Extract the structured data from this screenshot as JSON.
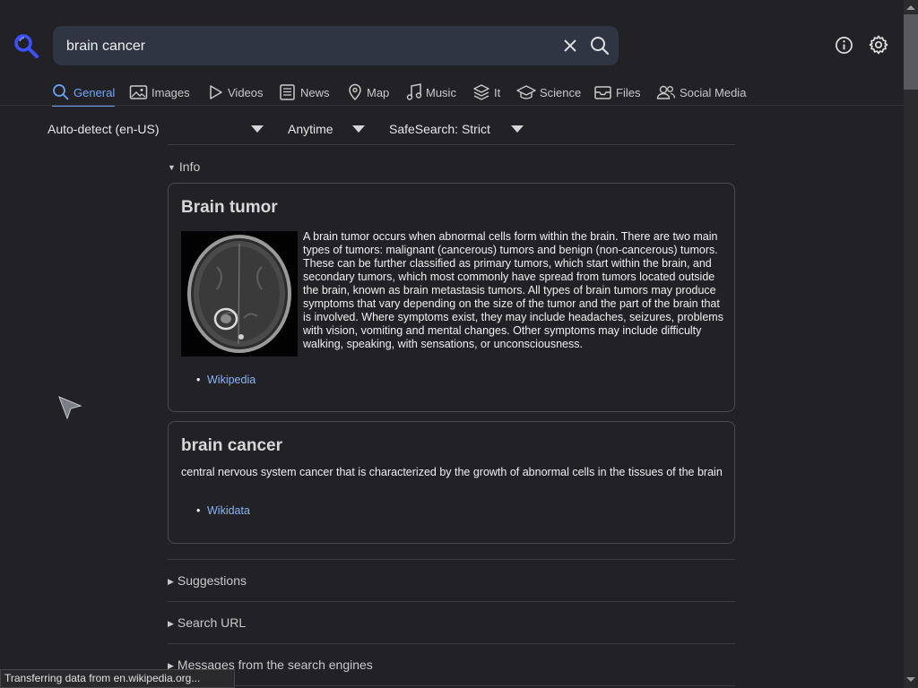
{
  "search": {
    "query": "brain cancer"
  },
  "tabs": [
    {
      "label": "General",
      "icon": "search-icon"
    },
    {
      "label": "Images",
      "icon": "image-icon"
    },
    {
      "label": "Videos",
      "icon": "play-icon"
    },
    {
      "label": "News",
      "icon": "newspaper-icon"
    },
    {
      "label": "Map",
      "icon": "map-pin-icon"
    },
    {
      "label": "Music",
      "icon": "music-note-icon"
    },
    {
      "label": "It",
      "icon": "layers-icon"
    },
    {
      "label": "Science",
      "icon": "graduation-cap-icon"
    },
    {
      "label": "Files",
      "icon": "inbox-icon"
    },
    {
      "label": "Social Media",
      "icon": "people-icon"
    }
  ],
  "filters": {
    "language": "Auto-detect (en-US)",
    "time": "Anytime",
    "safesearch": "SafeSearch: Strict"
  },
  "info": {
    "toggle_label": "Info",
    "infobox1": {
      "title": "Brain tumor",
      "description": "A brain tumor occurs when abnormal cells form within the brain. There are two main types of tumors: malignant (cancerous) tumors and benign (non-cancerous) tumors. These can be further classified as primary tumors, which start within the brain, and secondary tumors, which most commonly have spread from tumors located outside the brain, known as brain metastasis tumors. All types of brain tumors may produce symptoms that vary depending on the size of the tumor and the part of the brain that is involved. Where symptoms exist, they may include headaches, seizures, problems with vision, vomiting and mental changes. Other symptoms may include difficulty walking, speaking, with sensations, or unconsciousness.",
      "link": "Wikipedia"
    },
    "infobox2": {
      "title": "brain cancer",
      "description": "central nervous system cancer that is characterized by the growth of abnormal cells in the tissues of the brain",
      "link": "Wikidata"
    }
  },
  "sections": {
    "suggestions": "Suggestions",
    "search_url": "Search URL",
    "messages": "Messages from the search engines"
  },
  "status_bar": "Transferring data from en.wikipedia.org...",
  "colors": {
    "background": "#222226",
    "accent": "#6ea6ff",
    "link": "#8ab4f8",
    "search_bg": "#2f3542"
  }
}
